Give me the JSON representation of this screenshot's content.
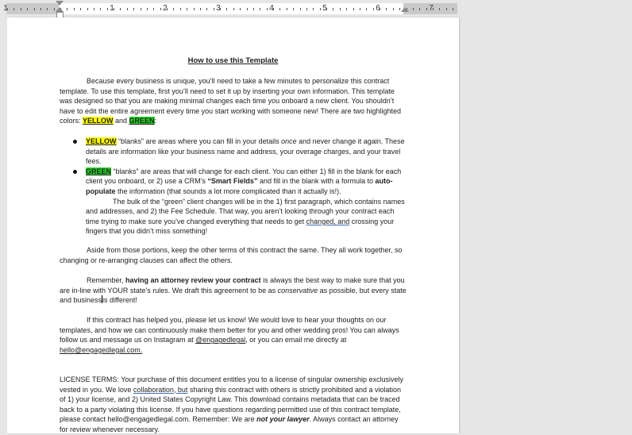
{
  "ruler": {
    "numbers": [
      "1",
      "1",
      "2",
      "3",
      "4",
      "5",
      "6",
      "7"
    ]
  },
  "doc": {
    "title": "How to use this Template",
    "p1": {
      "text": "Because every business is unique, you’ll need to take a few minutes to personalize this contract template.  To use this template, first you’ll need to set it up by inserting your own information. This template was designed so that you are making minimal changes each time you onboard a new client. You shouldn’t have to edit the entire agreement every time you start working with someone new! There are two highlighted colors: ",
      "yellow": "YELLOW",
      "and": " and ",
      "green": "GREEN",
      "end": ":"
    },
    "bullet1": {
      "label": "YELLOW",
      "t1": " “blanks” are areas where you can fill in your details ",
      "em": "once",
      "t2": " and never change it again. These details are information like your business name and address, your overage charges, and your travel fees."
    },
    "bullet2": {
      "label": "GREEN",
      "t1": " “blanks” are areas that will change for each client.  You can either 1) fill in the blank for each client you onboard, or 2) use a CRM’s ",
      "b1": "“Smart Fields”",
      "t2": " and fill in the blank with a formula to ",
      "b2": "auto-populate",
      "t3": " the information (that sounds a lot more complicated than it actually is!)."
    },
    "p2": {
      "t1": "The bulk of the “green” client changes will be in the 1) first paragraph, which contains names and addresses, and 2) the Fee Schedule. That way, you aren’t looking through your contract each time trying to make sure you’ve changed everything that needs to get ",
      "u": "changed, and",
      "t2": " crossing your fingers that you didn’t miss something!"
    },
    "p3": "Aside from those portions, keep the other terms of this contract the same. They all work together, so changing or re-arranging clauses can affect the others.",
    "p4": {
      "t1": "Remember, ",
      "b": "having an attorney review your contract",
      "t2": " is always the best way to make sure that you are in-line with YOUR state’s rules. We draft this agreement to be as ",
      "em": "conservative",
      "t3": " as possible, but every state and business",
      "t4": "is different!"
    },
    "p5": {
      "t1": "If this contract has helped you, please let us know! We would love to hear your thoughts on our templates, and how we can continuously make them better for you and other wedding pros!  You can always follow us and message us on Instagram at ",
      "handle": "@engagedlegal",
      "t2": ", or you can email me directly at ",
      "email": "hello@engagedlegal.com."
    },
    "license": {
      "t1": "LICENSE TERMS: Your purchase of this document entitles you to a license of singular ownership exclusively vested in you. We love ",
      "u": "collaboration, but",
      "t2": " sharing this contract with others is strictly prohibited and a violation of 1) your license, and 2) United States Copyright Law.  This download contains metadata that can be traced back to a party violating this license.  If you have questions regarding permitted use of this contract template, please contact hello@engagedlegal.com. Remember: We are ",
      "b": "not your lawyer",
      "t3": ".  Always contact an attorney for review whenever necessary."
    }
  }
}
